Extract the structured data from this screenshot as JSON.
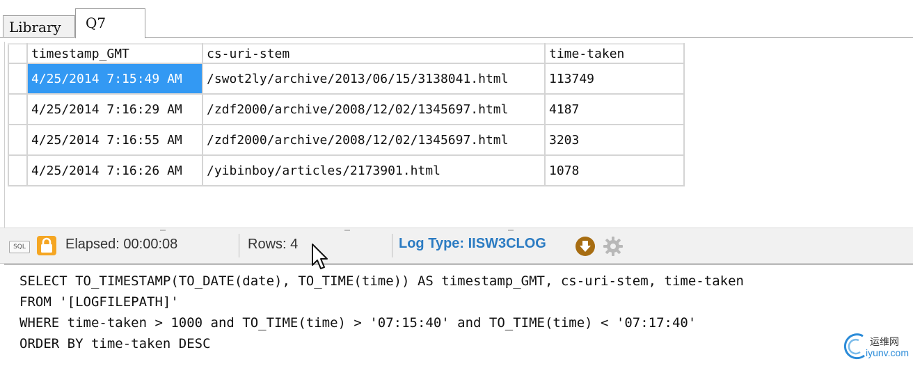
{
  "tabs": [
    {
      "label": "Library"
    },
    {
      "label": "Q7"
    }
  ],
  "grid": {
    "columns": [
      "timestamp_GMT",
      "cs-uri-stem",
      "time-taken"
    ],
    "rows": [
      [
        "4/25/2014 7:15:49 AM",
        "/swot2ly/archive/2013/06/15/3138041.html",
        "113749"
      ],
      [
        "4/25/2014 7:16:29 AM",
        "/zdf2000/archive/2008/12/02/1345697.html",
        "4187"
      ],
      [
        "4/25/2014 7:16:55 AM",
        "/zdf2000/archive/2008/12/02/1345697.html",
        "3203"
      ],
      [
        "4/25/2014 7:16:26 AM",
        "/yibinboy/articles/2173901.html",
        "1078"
      ]
    ]
  },
  "status": {
    "sql_icon_label": "SQL",
    "elapsed": "Elapsed: 00:00:08",
    "rows": "Rows: 4",
    "log_type": "Log Type: IISW3CLOG",
    "colors": {
      "log_type": "#2b7bc2",
      "lock": "#f5a623",
      "selection": "#3399f3"
    }
  },
  "query": {
    "lines": [
      "SELECT TO_TIMESTAMP(TO_DATE(date), TO_TIME(time)) AS timestamp_GMT, cs-uri-stem, time-taken",
      "FROM '[LOGFILEPATH]'",
      "WHERE time-taken > 1000 and TO_TIME(time) > '07:15:40' and TO_TIME(time) < '07:17:40'",
      "ORDER BY time-taken DESC"
    ]
  },
  "watermark": {
    "cn": "运维网",
    "en": "iyunv.com"
  }
}
